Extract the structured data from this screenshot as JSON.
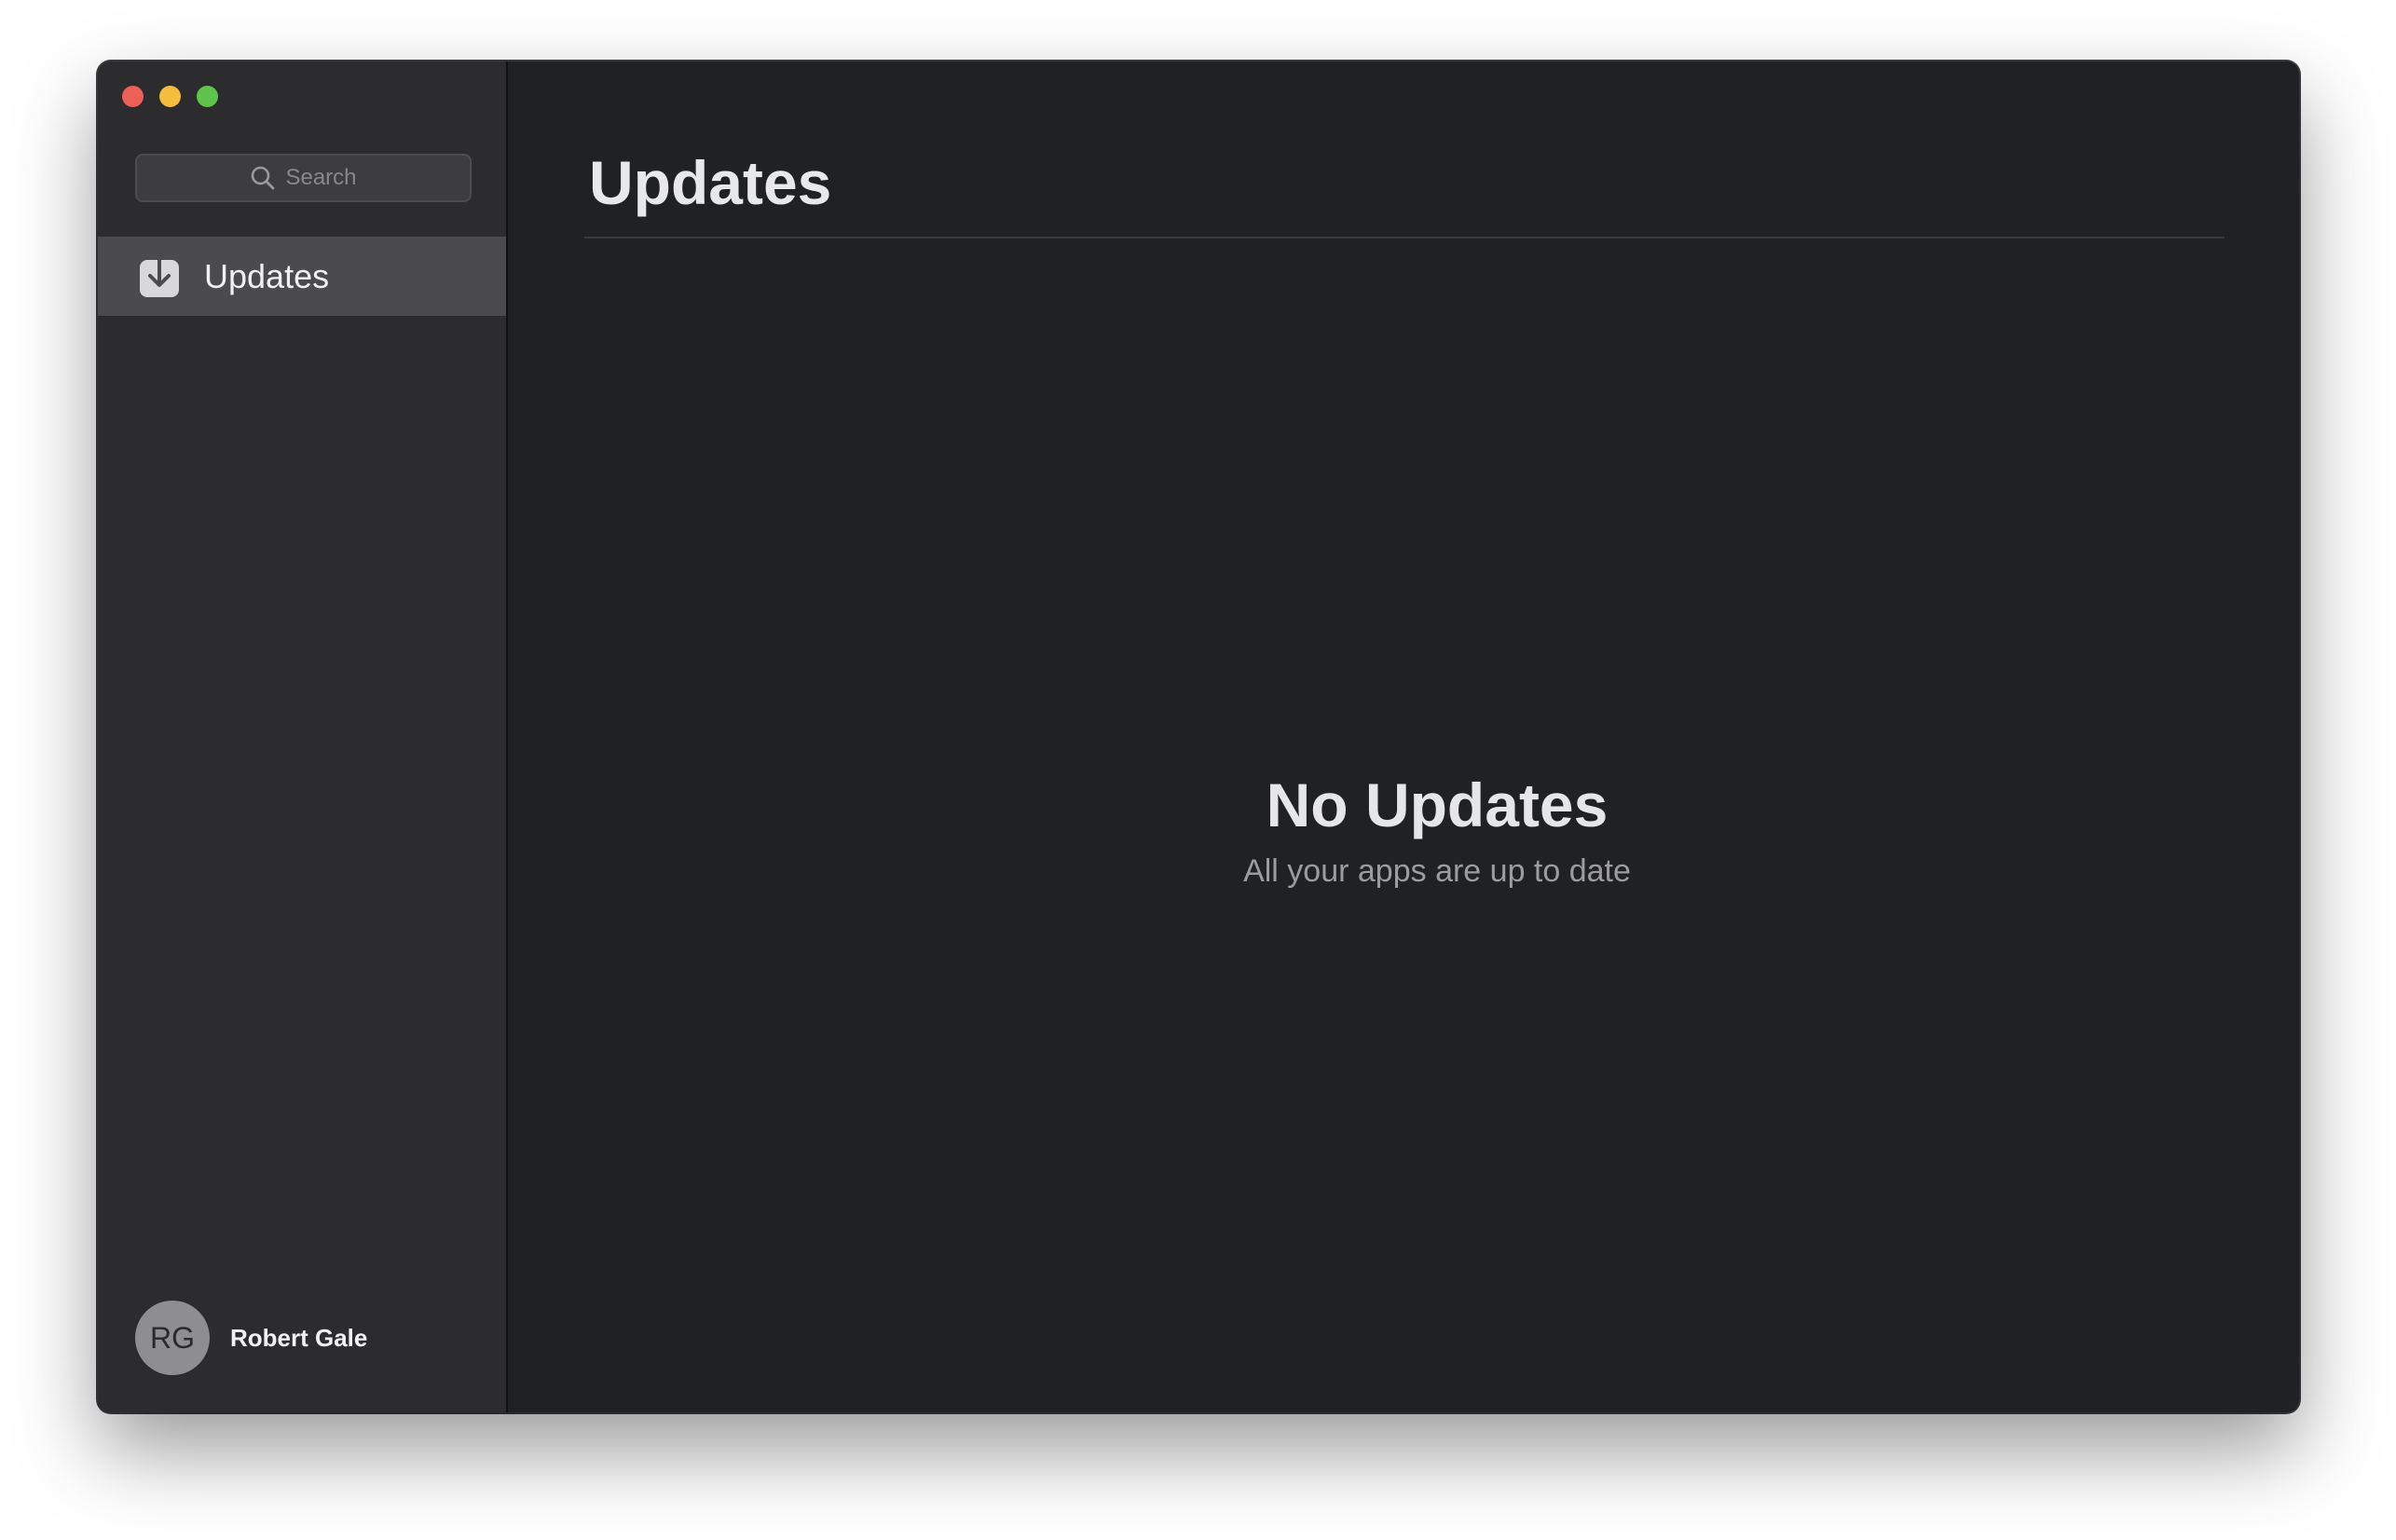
{
  "window": {
    "controls": [
      "close",
      "minimize",
      "maximize"
    ],
    "colors": {
      "close": "#ee5f57",
      "minimize": "#f4bd3e",
      "maximize": "#5fc44b"
    }
  },
  "sidebar": {
    "search": {
      "placeholder": "Search",
      "icon": "search-icon"
    },
    "items": [
      {
        "label": "Updates",
        "icon": "download-icon",
        "selected": true
      }
    ],
    "user": {
      "initials": "RG",
      "name": "Robert Gale"
    }
  },
  "main": {
    "title": "Updates",
    "empty_state": {
      "title": "No Updates",
      "subtitle": "All your apps are up to date"
    }
  }
}
